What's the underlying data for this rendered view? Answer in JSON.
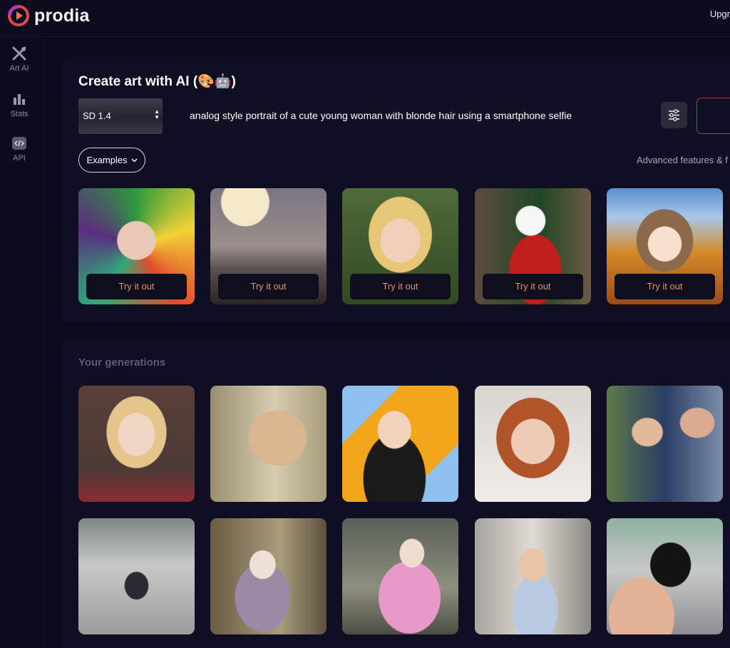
{
  "app": {
    "name": "prodia",
    "upgrade_label": "Upgr"
  },
  "sidebar": {
    "items": [
      {
        "label": "Art AI",
        "icon": "paintbrush-cross-icon"
      },
      {
        "label": "Stats",
        "icon": "bar-chart-icon"
      },
      {
        "label": "API",
        "icon": "code-icon"
      }
    ]
  },
  "create": {
    "title": "Create art with AI (🎨🤖)",
    "model_value": "SD 1.4",
    "prompt_value": "analog style portrait of a cute young woman with blonde hair using a smartphone selfie",
    "examples_label": "Examples",
    "advanced_label": "Advanced features & f"
  },
  "examples": {
    "try_label": "Try it out",
    "count": 5
  },
  "generations": {
    "title": "Your generations",
    "count": 10
  },
  "colors": {
    "background": "#0b0a1c",
    "panel": "#0f0e23",
    "try_text": "#e39467",
    "generate_border": "#c4313f"
  }
}
